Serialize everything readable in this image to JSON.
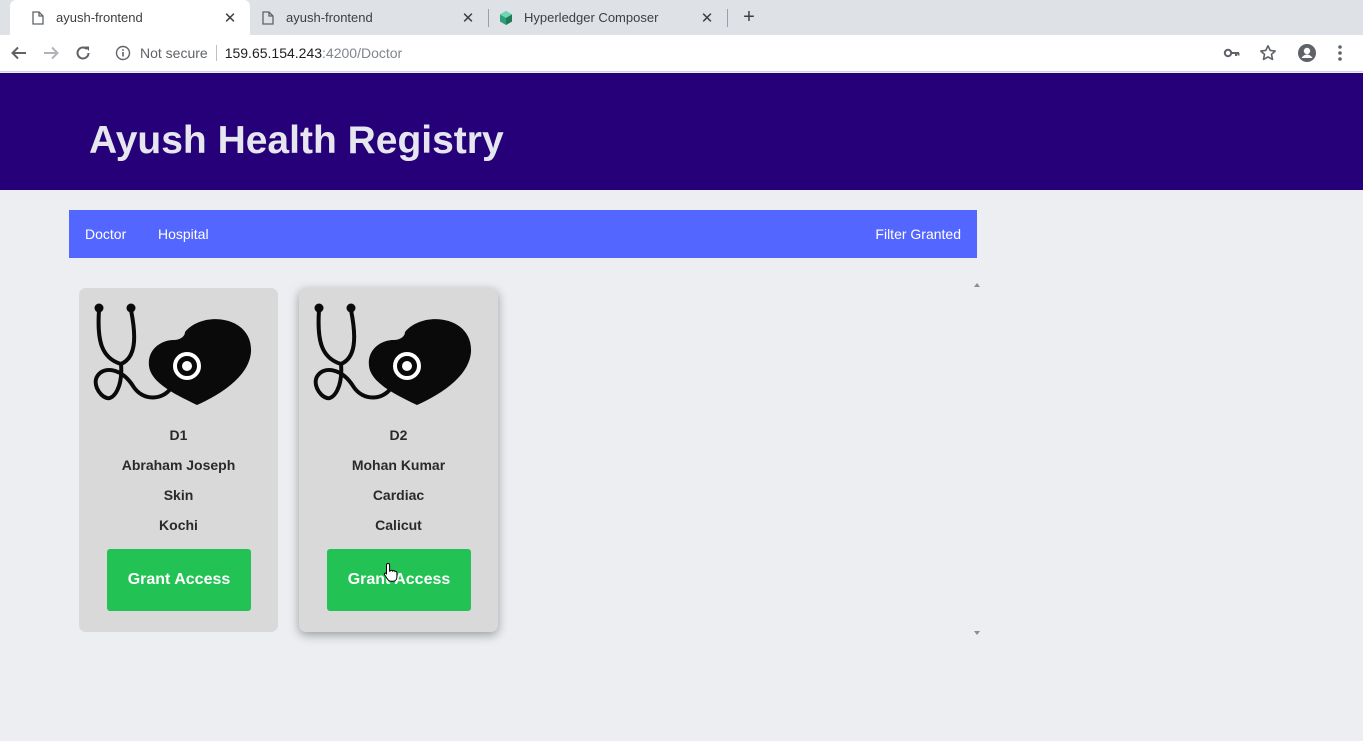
{
  "browser": {
    "tabs": [
      {
        "title": "ayush-frontend",
        "icon": "page-icon",
        "active": true
      },
      {
        "title": "ayush-frontend",
        "icon": "page-icon",
        "active": false
      },
      {
        "title": "Hyperledger Composer",
        "icon": "hyperledger-cube-icon",
        "active": false
      }
    ],
    "new_tab_label": "+",
    "close_label": "✕",
    "address": {
      "security_text": "Not secure",
      "host": "159.65.154.243",
      "path": ":4200/Doctor"
    }
  },
  "header": {
    "title": "Ayush Health Registry",
    "background": "#260078"
  },
  "navbar": {
    "background": "#5366ff",
    "links": [
      "Doctor",
      "Hospital"
    ],
    "right_link": "Filter Granted"
  },
  "doctors": [
    {
      "id": "D1",
      "name": "Abraham Joseph",
      "specialty": "Skin",
      "city": "Kochi",
      "button": "Grant Access"
    },
    {
      "id": "D2",
      "name": "Mohan Kumar",
      "specialty": "Cardiac",
      "city": "Calicut",
      "button": "Grant Access"
    }
  ],
  "colors": {
    "grant_button": "#22c354",
    "card": "#d9d9d9"
  }
}
